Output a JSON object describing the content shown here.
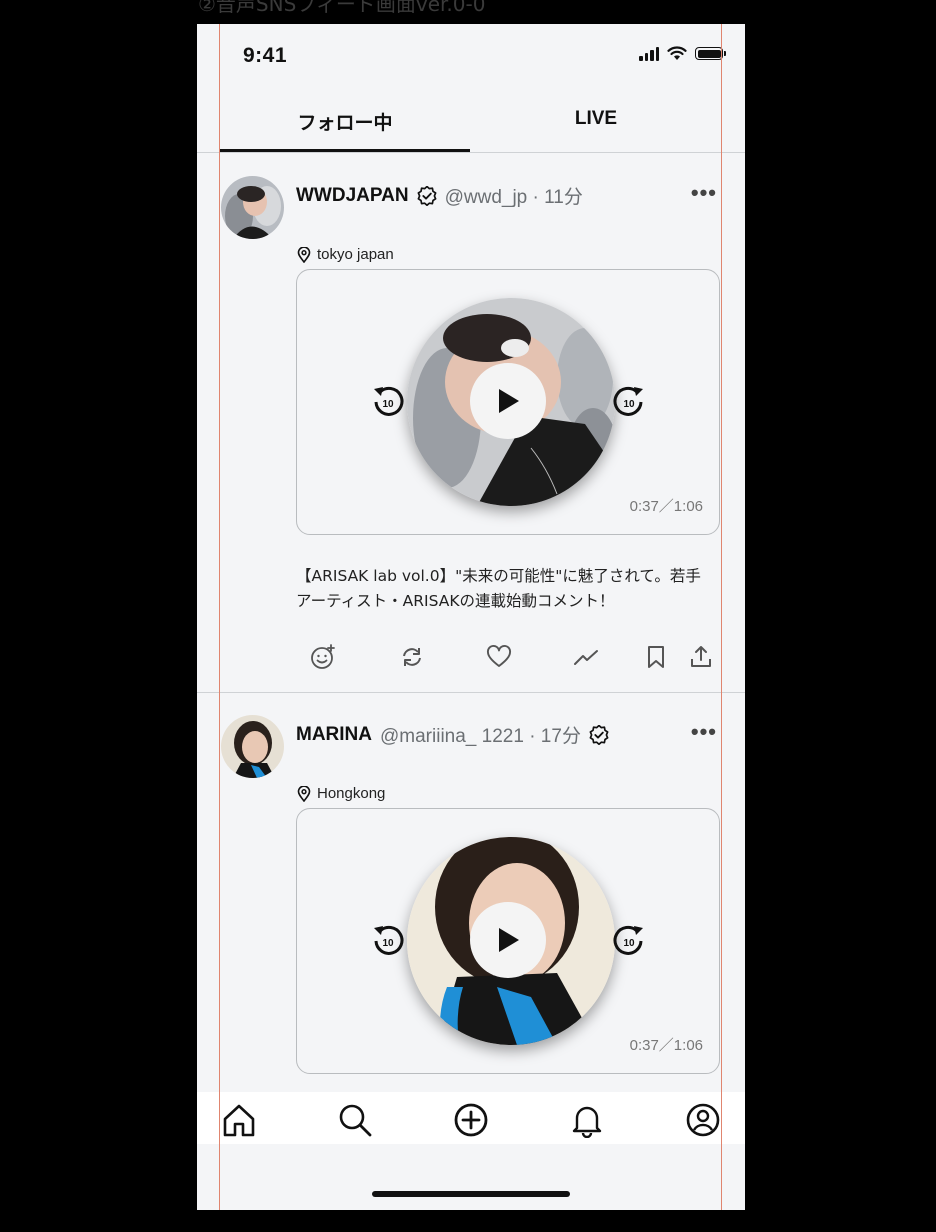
{
  "header_caption": "②音声SNSフィード画面ver.0-0",
  "status_bar": {
    "time": "9:41"
  },
  "tabs": [
    {
      "label": "フォロー中",
      "active": true
    },
    {
      "label": "LIVE",
      "active": false
    }
  ],
  "posts": [
    {
      "author": "WWDJAPAN",
      "handle": "@wwd_jp · 11分",
      "verified": true,
      "location": "tokyo japan",
      "time_readout": "0:37／1:06",
      "caption": "【ARISAK lab vol.0】\"未来の可能性\"に魅了されて。若手アーティスト・ARISAKの連載始動コメント！",
      "skip_back_label": "10",
      "skip_forward_label": "10"
    },
    {
      "author": "MARINA",
      "handle": "@mariiina_ 1221 · 17分",
      "verified": true,
      "location": "Hongkong",
      "time_readout": "0:37／1:06",
      "skip_back_label": "10",
      "skip_forward_label": "10"
    }
  ],
  "icons": {
    "post_actions": [
      "emoji-add-icon",
      "repost-icon",
      "heart-icon",
      "analytics-icon",
      "bookmark-icon",
      "share-icon"
    ],
    "bottom_nav": [
      "home-icon",
      "search-icon",
      "add-icon",
      "bell-icon",
      "profile-icon"
    ]
  },
  "colors": {
    "background": "#f4f5f7",
    "guide_lines": "#e0856f",
    "text_secondary": "#6b6f73"
  }
}
